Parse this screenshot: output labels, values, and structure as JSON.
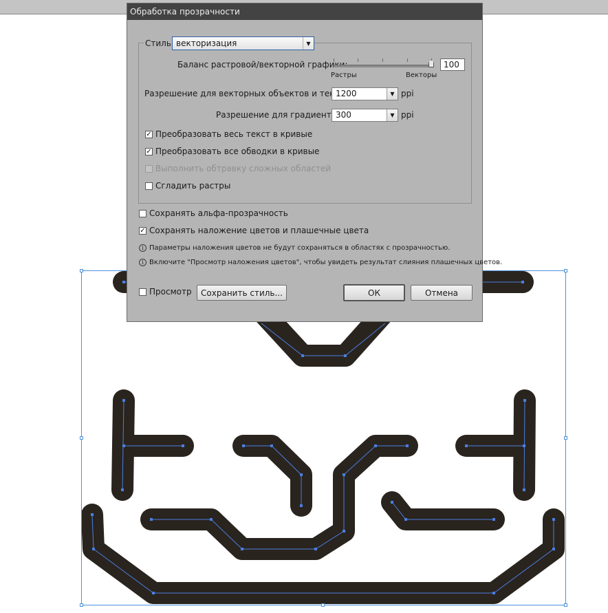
{
  "dialog": {
    "title": "Обработка прозрачности",
    "style_label": "Стиль:",
    "style_value": "векторизация",
    "balance_label": "Баланс растровой/векторной графики:",
    "balance_value": "100",
    "balance_level": 1.0,
    "slider_left_label": "Растры",
    "slider_right_label": "Векторы",
    "vector_res_label": "Разрешение для векторных объектов и текста:",
    "vector_res_value": "1200",
    "gradient_res_label": "Разрешение для градиентов:",
    "gradient_res_value": "300",
    "ppi_label": "ppi",
    "options": [
      {
        "label": "Преобразовать весь текст в кривые",
        "checked": true,
        "enabled": true
      },
      {
        "label": "Преобразовать все обводки в кривые",
        "checked": true,
        "enabled": true
      },
      {
        "label": "Выполнить обтравку сложных областей",
        "checked": false,
        "enabled": false
      },
      {
        "label": "Сгладить растры",
        "checked": false,
        "enabled": true
      }
    ],
    "keep_alpha_label": "Сохранять альфа-прозрачность",
    "keep_alpha_checked": false,
    "keep_overprint_label": "Сохранять наложение цветов и плашечные цвета",
    "keep_overprint_checked": true,
    "info_1": "Параметры наложения цветов не будут сохраняться в областях с прозрачностью.",
    "info_2": "Включите \"Просмотр наложения цветов\", чтобы увидеть результат слияния плашечных цветов.",
    "preview_label": "Просмотр",
    "preview_checked": false,
    "save_style_label": "Сохранить стиль...",
    "ok_label": "ОК",
    "cancel_label": "Отмена"
  },
  "colors": {
    "stroke": "#2a241f",
    "path": "#4a7fe0",
    "selection": "#4a90d9"
  }
}
